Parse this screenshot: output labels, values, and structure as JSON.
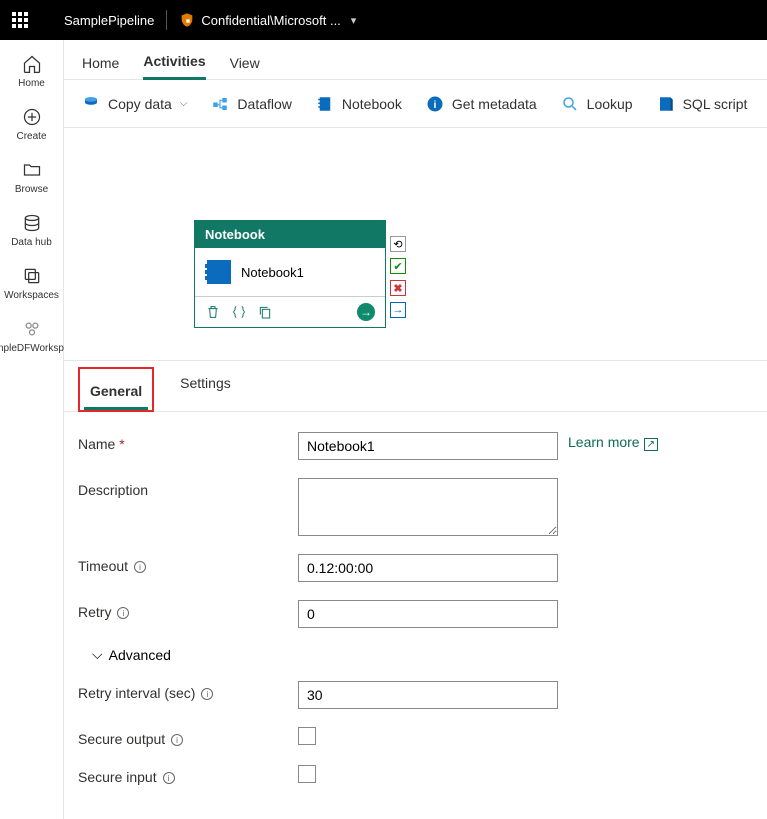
{
  "topbar": {
    "pipeline_name": "SamplePipeline",
    "sensitivity": "Confidential\\Microsoft ..."
  },
  "leftRail": {
    "home": "Home",
    "create": "Create",
    "browse": "Browse",
    "datahub": "Data hub",
    "workspaces": "Workspaces",
    "sampleWs": "SampleDFWorkspace"
  },
  "tabs": {
    "home": "Home",
    "activities": "Activities",
    "view": "View"
  },
  "toolbar": {
    "copydata": "Copy data",
    "dataflow": "Dataflow",
    "notebook": "Notebook",
    "getmeta": "Get metadata",
    "lookup": "Lookup",
    "sqlscript": "SQL script"
  },
  "activity": {
    "header": "Notebook",
    "name": "Notebook1"
  },
  "propsTabs": {
    "general": "General",
    "settings": "Settings"
  },
  "form": {
    "name_label": "Name",
    "name_value": "Notebook1",
    "desc_label": "Description",
    "desc_value": "",
    "timeout_label": "Timeout",
    "timeout_value": "0.12:00:00",
    "retry_label": "Retry",
    "retry_value": "0",
    "advanced": "Advanced",
    "retry_int_label": "Retry interval (sec)",
    "retry_int_value": "30",
    "secure_out_label": "Secure output",
    "secure_in_label": "Secure input",
    "learn_more": "Learn more"
  }
}
